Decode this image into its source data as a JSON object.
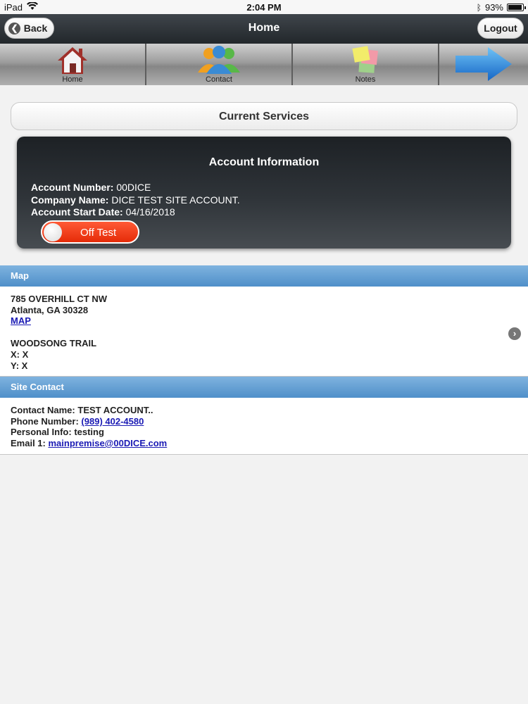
{
  "status_bar": {
    "device": "iPad",
    "time": "2:04 PM",
    "battery": "93%"
  },
  "nav": {
    "back_label": "Back",
    "title": "Home",
    "logout_label": "Logout"
  },
  "toolbar": [
    {
      "label": "Home",
      "icon": "house-icon"
    },
    {
      "label": "Contact",
      "icon": "contacts-icon"
    },
    {
      "label": "Notes",
      "icon": "sticky-notes-icon"
    },
    {
      "label": "",
      "icon": "next-arrow-icon"
    }
  ],
  "services": {
    "label": "Current Services"
  },
  "account": {
    "heading": "Account Information",
    "number_label": "Account Number:",
    "number": "00DICE",
    "company_label": "Company Name:",
    "company": "DICE TEST SITE ACCOUNT.",
    "start_label": "Account Start Date:",
    "start_date": "04/16/2018",
    "toggle_label": "Off Test"
  },
  "map_section": {
    "title": "Map",
    "address_line1": "785 OVERHILL CT NW",
    "address_line2": "Atlanta, GA 30328",
    "map_link": "MAP",
    "place": "WOODSONG TRAIL",
    "x": "X: X",
    "y": "Y: X"
  },
  "site_contact": {
    "title": "Site Contact",
    "name_label": "Contact Name:",
    "name": "TEST ACCOUNT..",
    "phone_label": "Phone Number:",
    "phone": "(989) 402-4580",
    "personal_label": "Personal Info:",
    "personal": "testing",
    "email_label": "Email 1:",
    "email": "mainpremise@00DICE.com"
  },
  "colors": {
    "section_bar": "#4f8fc9",
    "toggle_off": "#e52b08",
    "link": "#1a1ab4"
  }
}
